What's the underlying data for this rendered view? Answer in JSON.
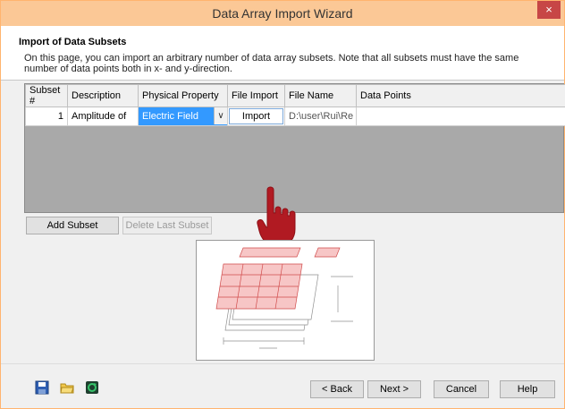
{
  "window": {
    "title": "Data Array Import Wizard",
    "close_label": "×"
  },
  "header": {
    "heading": "Import of Data Subsets",
    "description": "On this page, you can import an arbitrary number of data array subsets. Note that all subsets must have the same number of data points both in x- and y-direction."
  },
  "grid": {
    "columns": [
      "Subset #",
      "Description",
      "Physical Property",
      "File Import",
      "File Name",
      "Data Points"
    ],
    "rows": [
      {
        "subset": "1",
        "description": "Amplitude of",
        "property": "Electric Field",
        "import": "Import",
        "file_name": "D:\\user\\Rui\\Re",
        "data_points": ""
      }
    ]
  },
  "buttons": {
    "add_subset": "Add Subset",
    "delete_last_subset": "Delete Last Subset",
    "back": "< Back",
    "next": "Next >",
    "cancel": "Cancel",
    "help": "Help"
  },
  "colors": {
    "titlebar": "#fbc896",
    "close": "#c74646",
    "selection": "#3399ff",
    "hand": "#b11a22"
  }
}
